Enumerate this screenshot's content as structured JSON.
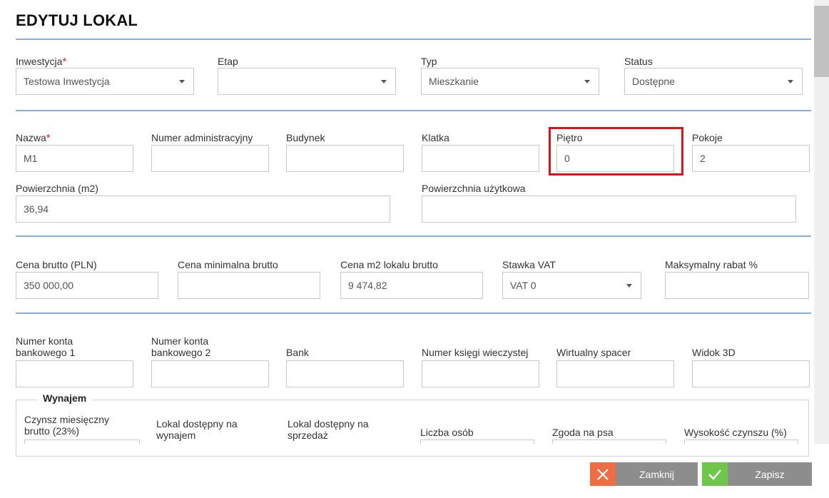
{
  "title": "EDYTUJ LOKAL",
  "required_mark": "*",
  "row1": {
    "inwestycja": {
      "label": "Inwestycja",
      "value": "Testowa Inwestycja"
    },
    "etap": {
      "label": "Etap",
      "value": ""
    },
    "typ": {
      "label": "Typ",
      "value": "Mieszkanie"
    },
    "status": {
      "label": "Status",
      "value": "Dostępne"
    }
  },
  "row2": {
    "nazwa": {
      "label": "Nazwa",
      "value": "M1"
    },
    "numer_adm": {
      "label": "Numer administracyjny",
      "value": ""
    },
    "budynek": {
      "label": "Budynek",
      "value": ""
    },
    "klatka": {
      "label": "Klatka",
      "value": ""
    },
    "pietro": {
      "label": "Piętro",
      "value": "0"
    },
    "pokoje": {
      "label": "Pokoje",
      "value": "2"
    }
  },
  "row3": {
    "powierzchnia": {
      "label": "Powierzchnia (m2)",
      "value": "36,94"
    },
    "powierzchnia_uzytkowa": {
      "label": "Powierzchnia użytkowa",
      "value": ""
    }
  },
  "row4": {
    "cena_brutto": {
      "label": "Cena brutto (PLN)",
      "value": "350 000,00"
    },
    "cena_min": {
      "label": "Cena minimalna brutto",
      "value": ""
    },
    "cena_m2": {
      "label": "Cena m2 lokalu brutto",
      "value": "9 474,82"
    },
    "stawka_vat": {
      "label": "Stawka VAT",
      "value": "VAT 0"
    },
    "rabat": {
      "label": "Maksymalny rabat %",
      "value": ""
    }
  },
  "row5": {
    "konto1": {
      "label_line1": "Numer konta",
      "label_line2": "bankowego 1",
      "value": ""
    },
    "konto2": {
      "label_line1": "Numer konta",
      "label_line2": "bankowego 2",
      "value": ""
    },
    "bank": {
      "label": "Bank",
      "value": ""
    },
    "ksiega": {
      "label": "Numer księgi wieczystej",
      "value": ""
    },
    "spacer": {
      "label": "Wirtualny spacer",
      "value": ""
    },
    "widok3d": {
      "label": "Widok 3D",
      "value": ""
    }
  },
  "wynajem": {
    "legend": "Wynajem",
    "czynsz": {
      "label_line1": "Czynsz miesięczny",
      "label_line2": "brutto (23%)"
    },
    "dostepny_wynajem": {
      "label_line1": "Lokal dostępny na",
      "label_line2": "wynajem"
    },
    "dostepny_sprzedaz": {
      "label_line1": "Lokal dostępny na",
      "label_line2": "sprzedaż"
    },
    "liczba_osob": {
      "label": "Liczba osób"
    },
    "zgoda_psa": {
      "label": "Zgoda na psa"
    },
    "wysokosc_czynszu": {
      "label": "Wysokość czynszu (%)"
    }
  },
  "buttons": {
    "close": "Zamknij",
    "save": "Zapisz"
  },
  "colors": {
    "accent_line": "#8aaed3",
    "highlight": "#d9141a",
    "close_icon_bg": "#ef6d43",
    "save_icon_bg": "#6fc64b",
    "button_bg": "#8d8d8d"
  }
}
